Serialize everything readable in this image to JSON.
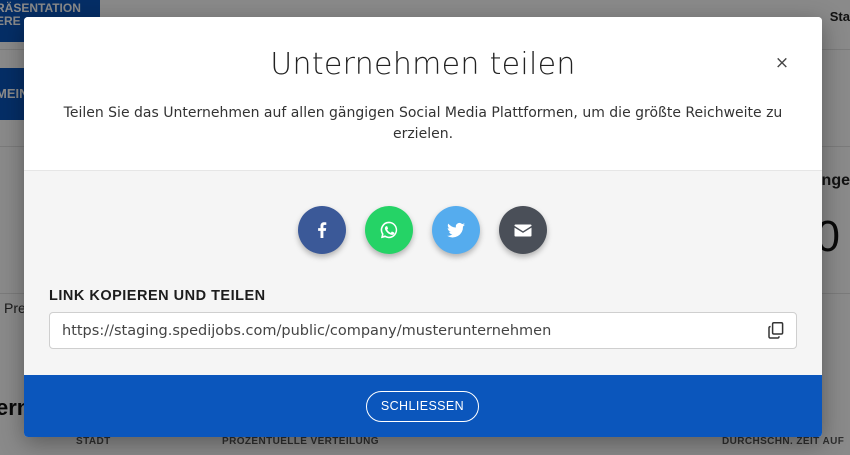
{
  "background": {
    "brand_line1": "RÄSENTATION",
    "brand_line2": "ERE",
    "nav_right": "Sta",
    "button_fragment": "MEIN",
    "stat_label": "inge",
    "stat_value": "0",
    "pre_text": "Pre",
    "section_heading": "ern",
    "columns": [
      "STADT",
      "PROZENTUELLE VERTEILUNG",
      "DURCHSCHN. ZEIT AUF"
    ]
  },
  "modal": {
    "title": "Unternehmen teilen",
    "close_symbol": "×",
    "description": "Teilen Sie das Unternehmen auf allen gängigen Social Media Plattformen, um die größte Reichweite zu erzielen.",
    "social": [
      {
        "name": "facebook",
        "icon": "facebook-icon",
        "color": "#3b5998"
      },
      {
        "name": "whatsapp",
        "icon": "whatsapp-icon",
        "color": "#25d366"
      },
      {
        "name": "twitter",
        "icon": "twitter-icon",
        "color": "#55acee"
      },
      {
        "name": "email",
        "icon": "envelope-icon",
        "color": "#4a4f58"
      }
    ],
    "link_label": "LINK KOPIEREN UND TEILEN",
    "link_value": "https://staging.spedijobs.com/public/company/musterunternehmen",
    "copy_icon": "copy-icon",
    "footer_button": "SCHLIESSEN",
    "footer_color": "#0b56bc"
  }
}
